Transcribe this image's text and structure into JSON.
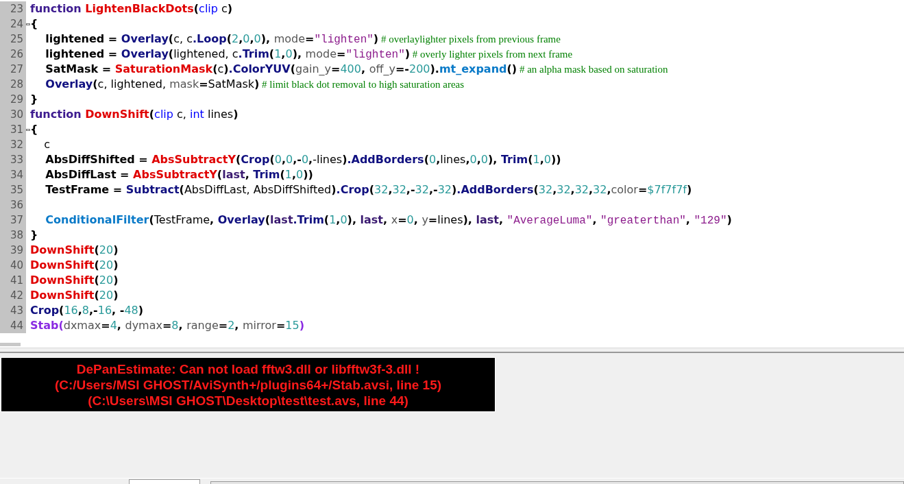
{
  "editor": {
    "lines": [
      {
        "number": "23",
        "fold": false,
        "tokens": [
          {
            "kind": "kw",
            "text": "function "
          },
          {
            "kind": "fn",
            "text": "LightenBlackDots"
          },
          {
            "kind": "op",
            "text": "("
          },
          {
            "kind": "type",
            "text": "clip "
          },
          {
            "kind": "plain",
            "text": "c"
          },
          {
            "kind": "op",
            "text": ")"
          }
        ]
      },
      {
        "number": "24",
        "fold": true,
        "tokens": [
          {
            "kind": "op",
            "text": "{"
          }
        ]
      },
      {
        "number": "25",
        "fold": false,
        "tokens": [
          {
            "kind": "var",
            "text": "    lightened"
          },
          {
            "kind": "op",
            "text": " = "
          },
          {
            "kind": "builtin",
            "text": "Overlay"
          },
          {
            "kind": "op",
            "text": "("
          },
          {
            "kind": "plain",
            "text": "c, c"
          },
          {
            "kind": "builtin",
            "text": ".Loop"
          },
          {
            "kind": "op",
            "text": "("
          },
          {
            "kind": "num",
            "text": "2"
          },
          {
            "kind": "op",
            "text": ","
          },
          {
            "kind": "num",
            "text": "0"
          },
          {
            "kind": "op",
            "text": ","
          },
          {
            "kind": "num",
            "text": "0"
          },
          {
            "kind": "op",
            "text": "), "
          },
          {
            "kind": "param",
            "text": "mode"
          },
          {
            "kind": "op",
            "text": "="
          },
          {
            "kind": "str",
            "text": "\"lighten\""
          },
          {
            "kind": "op",
            "text": ")"
          },
          {
            "kind": "comment",
            "text": " # overlaylighter pixels from previous frame"
          }
        ]
      },
      {
        "number": "26",
        "fold": false,
        "tokens": [
          {
            "kind": "var",
            "text": "    lightened"
          },
          {
            "kind": "op",
            "text": " = "
          },
          {
            "kind": "builtin",
            "text": "Overlay"
          },
          {
            "kind": "op",
            "text": "("
          },
          {
            "kind": "plain",
            "text": "lightened, c"
          },
          {
            "kind": "builtin",
            "text": ".Trim"
          },
          {
            "kind": "op",
            "text": "("
          },
          {
            "kind": "num",
            "text": "1"
          },
          {
            "kind": "op",
            "text": ","
          },
          {
            "kind": "num",
            "text": "0"
          },
          {
            "kind": "op",
            "text": "), "
          },
          {
            "kind": "param",
            "text": "mode"
          },
          {
            "kind": "op",
            "text": "="
          },
          {
            "kind": "str",
            "text": "\"lighten\""
          },
          {
            "kind": "op",
            "text": ")"
          },
          {
            "kind": "comment",
            "text": " # overly lighter pixels from next frame"
          }
        ]
      },
      {
        "number": "27",
        "fold": false,
        "tokens": [
          {
            "kind": "var",
            "text": "    SatMask"
          },
          {
            "kind": "op",
            "text": " = "
          },
          {
            "kind": "fn",
            "text": "SaturationMask"
          },
          {
            "kind": "op",
            "text": "("
          },
          {
            "kind": "plain",
            "text": "c"
          },
          {
            "kind": "op",
            "text": ")"
          },
          {
            "kind": "builtin",
            "text": ".ColorYUV"
          },
          {
            "kind": "op",
            "text": "("
          },
          {
            "kind": "param",
            "text": "gain_y"
          },
          {
            "kind": "op",
            "text": "="
          },
          {
            "kind": "num",
            "text": "400"
          },
          {
            "kind": "op",
            "text": ", "
          },
          {
            "kind": "param",
            "text": "off_y"
          },
          {
            "kind": "op",
            "text": "=-"
          },
          {
            "kind": "num",
            "text": "200"
          },
          {
            "kind": "op",
            "text": ")."
          },
          {
            "kind": "plugin",
            "text": "mt_expand"
          },
          {
            "kind": "op",
            "text": "()"
          },
          {
            "kind": "comment",
            "text": " # an alpha mask based on saturation"
          }
        ]
      },
      {
        "number": "28",
        "fold": false,
        "tokens": [
          {
            "kind": "builtin",
            "text": "    Overlay"
          },
          {
            "kind": "op",
            "text": "("
          },
          {
            "kind": "plain",
            "text": "c, lightened, "
          },
          {
            "kind": "param",
            "text": "mask"
          },
          {
            "kind": "op",
            "text": "="
          },
          {
            "kind": "plain",
            "text": "SatMask"
          },
          {
            "kind": "op",
            "text": ")"
          },
          {
            "kind": "comment",
            "text": " # limit black dot removal to high saturation areas"
          }
        ]
      },
      {
        "number": "29",
        "fold": false,
        "tokens": [
          {
            "kind": "op",
            "text": "}"
          }
        ]
      },
      {
        "number": "30",
        "fold": false,
        "tokens": [
          {
            "kind": "kw",
            "text": "function "
          },
          {
            "kind": "fn",
            "text": "DownShift"
          },
          {
            "kind": "op",
            "text": "("
          },
          {
            "kind": "type",
            "text": "clip "
          },
          {
            "kind": "plain",
            "text": "c, "
          },
          {
            "kind": "type",
            "text": "int "
          },
          {
            "kind": "plain",
            "text": "lines"
          },
          {
            "kind": "op",
            "text": ")"
          }
        ]
      },
      {
        "number": "31",
        "fold": true,
        "tokens": [
          {
            "kind": "op",
            "text": "{"
          }
        ]
      },
      {
        "number": "32",
        "fold": false,
        "tokens": [
          {
            "kind": "plain",
            "text": "    c"
          }
        ]
      },
      {
        "number": "33",
        "fold": false,
        "tokens": [
          {
            "kind": "var",
            "text": "    AbsDiffShifted"
          },
          {
            "kind": "op",
            "text": " = "
          },
          {
            "kind": "fn",
            "text": "AbsSubtractY"
          },
          {
            "kind": "op",
            "text": "("
          },
          {
            "kind": "builtin",
            "text": "Crop"
          },
          {
            "kind": "op",
            "text": "("
          },
          {
            "kind": "num",
            "text": "0"
          },
          {
            "kind": "op",
            "text": ","
          },
          {
            "kind": "num",
            "text": "0"
          },
          {
            "kind": "op",
            "text": ",-"
          },
          {
            "kind": "num",
            "text": "0"
          },
          {
            "kind": "op",
            "text": ","
          },
          {
            "kind": "plain",
            "text": "-lines"
          },
          {
            "kind": "op",
            "text": ")"
          },
          {
            "kind": "builtin",
            "text": ".AddBorders"
          },
          {
            "kind": "op",
            "text": "("
          },
          {
            "kind": "num",
            "text": "0"
          },
          {
            "kind": "op",
            "text": ","
          },
          {
            "kind": "plain",
            "text": "lines"
          },
          {
            "kind": "op",
            "text": ","
          },
          {
            "kind": "num",
            "text": "0"
          },
          {
            "kind": "op",
            "text": ","
          },
          {
            "kind": "num",
            "text": "0"
          },
          {
            "kind": "op",
            "text": "), "
          },
          {
            "kind": "builtin",
            "text": "Trim"
          },
          {
            "kind": "op",
            "text": "("
          },
          {
            "kind": "num",
            "text": "1"
          },
          {
            "kind": "op",
            "text": ","
          },
          {
            "kind": "num",
            "text": "0"
          },
          {
            "kind": "op",
            "text": "))"
          }
        ]
      },
      {
        "number": "34",
        "fold": false,
        "tokens": [
          {
            "kind": "var",
            "text": "    AbsDiffLast"
          },
          {
            "kind": "op",
            "text": " = "
          },
          {
            "kind": "fn",
            "text": "AbsSubtractY"
          },
          {
            "kind": "op",
            "text": "("
          },
          {
            "kind": "last",
            "text": "last"
          },
          {
            "kind": "op",
            "text": ", "
          },
          {
            "kind": "builtin",
            "text": "Trim"
          },
          {
            "kind": "op",
            "text": "("
          },
          {
            "kind": "num",
            "text": "1"
          },
          {
            "kind": "op",
            "text": ","
          },
          {
            "kind": "num",
            "text": "0"
          },
          {
            "kind": "op",
            "text": "))"
          }
        ]
      },
      {
        "number": "35",
        "fold": false,
        "tokens": [
          {
            "kind": "var",
            "text": "    TestFrame"
          },
          {
            "kind": "op",
            "text": " = "
          },
          {
            "kind": "builtin",
            "text": "Subtract"
          },
          {
            "kind": "op",
            "text": "("
          },
          {
            "kind": "plain",
            "text": "AbsDiffLast, AbsDiffShifted"
          },
          {
            "kind": "op",
            "text": ")"
          },
          {
            "kind": "builtin",
            "text": ".Crop"
          },
          {
            "kind": "op",
            "text": "("
          },
          {
            "kind": "num",
            "text": "32"
          },
          {
            "kind": "op",
            "text": ","
          },
          {
            "kind": "num",
            "text": "32"
          },
          {
            "kind": "op",
            "text": ",-"
          },
          {
            "kind": "num",
            "text": "32"
          },
          {
            "kind": "op",
            "text": ",-"
          },
          {
            "kind": "num",
            "text": "32"
          },
          {
            "kind": "op",
            "text": ")"
          },
          {
            "kind": "builtin",
            "text": ".AddBorders"
          },
          {
            "kind": "op",
            "text": "("
          },
          {
            "kind": "num",
            "text": "32"
          },
          {
            "kind": "op",
            "text": ","
          },
          {
            "kind": "num",
            "text": "32"
          },
          {
            "kind": "op",
            "text": ","
          },
          {
            "kind": "num",
            "text": "32"
          },
          {
            "kind": "op",
            "text": ","
          },
          {
            "kind": "num",
            "text": "32"
          },
          {
            "kind": "op",
            "text": ","
          },
          {
            "kind": "param",
            "text": "color"
          },
          {
            "kind": "op",
            "text": "="
          },
          {
            "kind": "num",
            "text": "$7f7f7f"
          },
          {
            "kind": "op",
            "text": ")"
          }
        ]
      },
      {
        "number": "36",
        "fold": false
      },
      {
        "number": "37",
        "fold": false,
        "tokens": [
          {
            "kind": "plugin",
            "text": "    ConditionalFilter"
          },
          {
            "kind": "op",
            "text": "("
          },
          {
            "kind": "plain",
            "text": "TestFrame"
          },
          {
            "kind": "op",
            "text": ", "
          },
          {
            "kind": "builtin",
            "text": "Overlay"
          },
          {
            "kind": "op",
            "text": "("
          },
          {
            "kind": "last",
            "text": "last"
          },
          {
            "kind": "builtin",
            "text": ".Trim"
          },
          {
            "kind": "op",
            "text": "("
          },
          {
            "kind": "num",
            "text": "1"
          },
          {
            "kind": "op",
            "text": ","
          },
          {
            "kind": "num",
            "text": "0"
          },
          {
            "kind": "op",
            "text": "), "
          },
          {
            "kind": "last",
            "text": "last"
          },
          {
            "kind": "op",
            "text": ", "
          },
          {
            "kind": "param",
            "text": "x"
          },
          {
            "kind": "op",
            "text": "="
          },
          {
            "kind": "num",
            "text": "0"
          },
          {
            "kind": "op",
            "text": ", "
          },
          {
            "kind": "param",
            "text": "y"
          },
          {
            "kind": "op",
            "text": "="
          },
          {
            "kind": "plain",
            "text": "lines"
          },
          {
            "kind": "op",
            "text": "), "
          },
          {
            "kind": "last",
            "text": "last"
          },
          {
            "kind": "op",
            "text": ", "
          },
          {
            "kind": "str",
            "text": "\"AverageLuma\""
          },
          {
            "kind": "op",
            "text": ", "
          },
          {
            "kind": "str",
            "text": "\"greaterthan\""
          },
          {
            "kind": "op",
            "text": ", "
          },
          {
            "kind": "str",
            "text": "\"129\""
          },
          {
            "kind": "op",
            "text": ")"
          }
        ]
      },
      {
        "number": "38",
        "fold": false,
        "tokens": [
          {
            "kind": "op",
            "text": "}"
          }
        ]
      },
      {
        "number": "39",
        "fold": false,
        "tokens": [
          {
            "kind": "fn",
            "text": "DownShift"
          },
          {
            "kind": "op",
            "text": "("
          },
          {
            "kind": "num",
            "text": "20"
          },
          {
            "kind": "op",
            "text": ")"
          }
        ]
      },
      {
        "number": "40",
        "fold": false,
        "tokens": [
          {
            "kind": "fn",
            "text": "DownShift"
          },
          {
            "kind": "op",
            "text": "("
          },
          {
            "kind": "num",
            "text": "20"
          },
          {
            "kind": "op",
            "text": ")"
          }
        ]
      },
      {
        "number": "41",
        "fold": false,
        "tokens": [
          {
            "kind": "fn",
            "text": "DownShift"
          },
          {
            "kind": "op",
            "text": "("
          },
          {
            "kind": "num",
            "text": "20"
          },
          {
            "kind": "op",
            "text": ")"
          }
        ]
      },
      {
        "number": "42",
        "fold": false,
        "tokens": [
          {
            "kind": "fn",
            "text": "DownShift"
          },
          {
            "kind": "op",
            "text": "("
          },
          {
            "kind": "num",
            "text": "20"
          },
          {
            "kind": "op",
            "text": ")"
          }
        ]
      },
      {
        "number": "43",
        "fold": false,
        "tokens": [
          {
            "kind": "builtin",
            "text": "Crop"
          },
          {
            "kind": "op",
            "text": "("
          },
          {
            "kind": "num",
            "text": "16"
          },
          {
            "kind": "op",
            "text": ","
          },
          {
            "kind": "num",
            "text": "8"
          },
          {
            "kind": "op",
            "text": ",-"
          },
          {
            "kind": "num",
            "text": "16"
          },
          {
            "kind": "op",
            "text": ", -"
          },
          {
            "kind": "num",
            "text": "48"
          },
          {
            "kind": "op",
            "text": ")"
          }
        ]
      },
      {
        "number": "44",
        "fold": false,
        "tokens": [
          {
            "kind": "stab",
            "text": "Stab("
          },
          {
            "kind": "param",
            "text": "dxmax"
          },
          {
            "kind": "op",
            "text": "="
          },
          {
            "kind": "num",
            "text": "4"
          },
          {
            "kind": "op",
            "text": ", "
          },
          {
            "kind": "param",
            "text": "dymax"
          },
          {
            "kind": "op",
            "text": "="
          },
          {
            "kind": "num",
            "text": "8"
          },
          {
            "kind": "op",
            "text": ", "
          },
          {
            "kind": "param",
            "text": "range"
          },
          {
            "kind": "op",
            "text": "="
          },
          {
            "kind": "num",
            "text": "2"
          },
          {
            "kind": "op",
            "text": ", "
          },
          {
            "kind": "param",
            "text": "mirror"
          },
          {
            "kind": "op",
            "text": "="
          },
          {
            "kind": "num",
            "text": "15"
          },
          {
            "kind": "stab",
            "text": ")"
          }
        ]
      }
    ]
  },
  "error": {
    "lines": [
      "DePanEstimate: Can not load fftw3.dll or libfftw3f-3.dll !",
      "(C:/Users/MSI GHOST/AviSynth+/plugins64+/Stab.avsi, line 15)",
      "(C:\\Users\\MSI GHOST\\Desktop\\test\\test.avs, line 44)"
    ]
  }
}
